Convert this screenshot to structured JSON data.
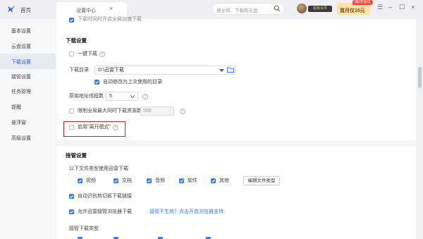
{
  "titlebar": {
    "home_label": "首页",
    "tab_label": "设置中心",
    "tab_close": "×",
    "search_placeholder": "搜全网、下载和云盘",
    "vip_badge": "超级会员",
    "promo_label": "首月仅10元",
    "promo_tag": "抽3天会员",
    "window_buttons": [
      "☰",
      "–",
      "☐",
      "×"
    ]
  },
  "sidebar": {
    "items": [
      {
        "label": "基本设置"
      },
      {
        "label": "云盘设置"
      },
      {
        "label": "下载设置",
        "active": true
      },
      {
        "label": "接管设置"
      },
      {
        "label": "任务管理"
      },
      {
        "label": "提醒"
      },
      {
        "label": "悬浮窗"
      },
      {
        "label": "高级设置"
      }
    ]
  },
  "download": {
    "top_partial": "下载时同时开启全局加速下载",
    "section_title": "下载设置",
    "one_click": {
      "label": "一键下载",
      "checked": false
    },
    "dir_label": "下载目录",
    "dir_value": "D:\\迅雷下载",
    "auto_modify": {
      "label": "自动修改为上次使用的目录",
      "checked": true
    },
    "threads_label": "原始地址线程数",
    "threads_value": "5",
    "limit_tasks": {
      "label": "限制全局最大同时下载资源数",
      "checked": false
    },
    "limit_value": "500",
    "open_mode": {
      "label": "启用\"离开模式\"",
      "checked": false
    }
  },
  "takeover": {
    "section_title": "接管设置",
    "filetypes_label": "以下文件类型使用迅雷下载",
    "filetypes": [
      {
        "label": "视频",
        "checked": true
      },
      {
        "label": "文档",
        "checked": true
      },
      {
        "label": "音频",
        "checked": true
      },
      {
        "label": "软件",
        "checked": true
      },
      {
        "label": "其他",
        "checked": true
      }
    ],
    "edit_button": "编辑文件类型",
    "clipboard": {
      "label": "自动识别剪切板下载链接",
      "checked": true
    },
    "browser": {
      "label": "允许迅雷接管浏览器下载",
      "checked": true
    },
    "browser_link": "接管不生效？点击开启浏览器支持",
    "types_label": "接管下载类型"
  },
  "colors": {
    "accent": "#3a78f2",
    "checkbox_checked": "#3b7cf5",
    "highlight": "#d21f1f"
  }
}
